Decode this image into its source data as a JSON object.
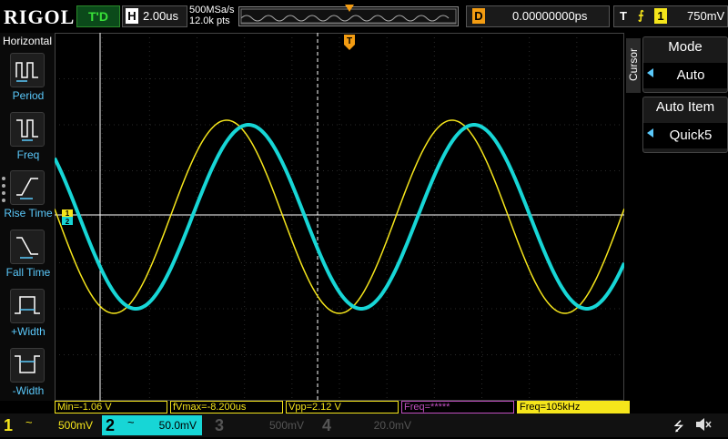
{
  "top": {
    "logo": "RIGOL",
    "run_status": "T'D",
    "horiz_label": "H",
    "timebase": "2.00us",
    "sample_rate": "500MSa/s",
    "mem_depth": "12.0k pts",
    "delay_label": "D",
    "delay": "0.00000000ps",
    "trig_label": "T",
    "trig_source": "1",
    "trig_level": "750mV"
  },
  "left_menu": {
    "title": "Horizontal",
    "items": [
      {
        "label": "Period",
        "icon": "period-icon"
      },
      {
        "label": "Freq",
        "icon": "freq-icon"
      },
      {
        "label": "Rise Time",
        "icon": "rise-time-icon"
      },
      {
        "label": "Fall Time",
        "icon": "fall-time-icon"
      },
      {
        "label": "+Width",
        "icon": "pos-width-icon"
      },
      {
        "label": "-Width",
        "icon": "neg-width-icon"
      }
    ]
  },
  "right_panel": {
    "tab": "Cursor",
    "mode_title": "Mode",
    "mode_value": "Auto",
    "item_title": "Auto Item",
    "item_value": "Quick5"
  },
  "markers": {
    "trigger_pos": "T",
    "ch1_ground": "1",
    "ch2_ground": "2",
    "trig_level_marker": "T"
  },
  "measurements": [
    {
      "text": "Min=-1.06 V",
      "color": "#f5e51b"
    },
    {
      "text": "fVmax=-8.200us",
      "color": "#f5e51b"
    },
    {
      "text": "Vpp=2.12 V",
      "color": "#f5e51b"
    },
    {
      "text": "Freq=*****",
      "color": "#c04fc0"
    },
    {
      "text": "Freq=105kHz",
      "color": "#f5e51b"
    }
  ],
  "channels": [
    {
      "num": "1",
      "coupling": "~",
      "scale": "500mV",
      "color": "#f5e51b",
      "active": false
    },
    {
      "num": "2",
      "coupling": "~",
      "scale": "50.0mV",
      "color": "#17d6d6",
      "active": true
    },
    {
      "num": "3",
      "coupling": "",
      "scale": "500mV",
      "color": "#555555",
      "active": false
    },
    {
      "num": "4",
      "coupling": "",
      "scale": "20.0mV",
      "color": "#555555",
      "active": false
    }
  ],
  "colors": {
    "ch1": "#f5e51b",
    "ch2": "#17d6d6",
    "accent": "#5ac8fa",
    "delay_tag": "#f39c12"
  },
  "chart_data": {
    "type": "line",
    "title": "",
    "xlabel": "",
    "ylabel": "",
    "x_unit": "div",
    "y_unit": "div",
    "xlim": [
      -6,
      6
    ],
    "ylim": [
      -4,
      4
    ],
    "grid": true,
    "series": [
      {
        "color": "#f5e51b",
        "amplitude_div": 2.1,
        "period_div": 4.75,
        "phase_deg": 0,
        "x": [
          -5.5,
          -4.3,
          -3.1,
          -1.9,
          -0.7,
          0.5,
          1.7,
          2.9,
          4.1,
          5.3
        ],
        "y": [
          -1.1,
          1.6,
          2.0,
          -1.0,
          -2.0,
          0.3,
          2.1,
          0.6,
          -2.0,
          1.6
        ]
      },
      {
        "color": "#17d6d6",
        "amplitude_div": 2.0,
        "period_div": 4.75,
        "phase_deg": -35,
        "x": [
          -5.5,
          -4.3,
          -3.1,
          -1.9,
          -0.7,
          0.5,
          1.7,
          2.9,
          4.1,
          5.3
        ],
        "y": [
          -1.7,
          0.9,
          2.0,
          -0.1,
          -2.0,
          -0.6,
          1.8,
          1.3,
          -1.5,
          1.9
        ]
      }
    ]
  }
}
